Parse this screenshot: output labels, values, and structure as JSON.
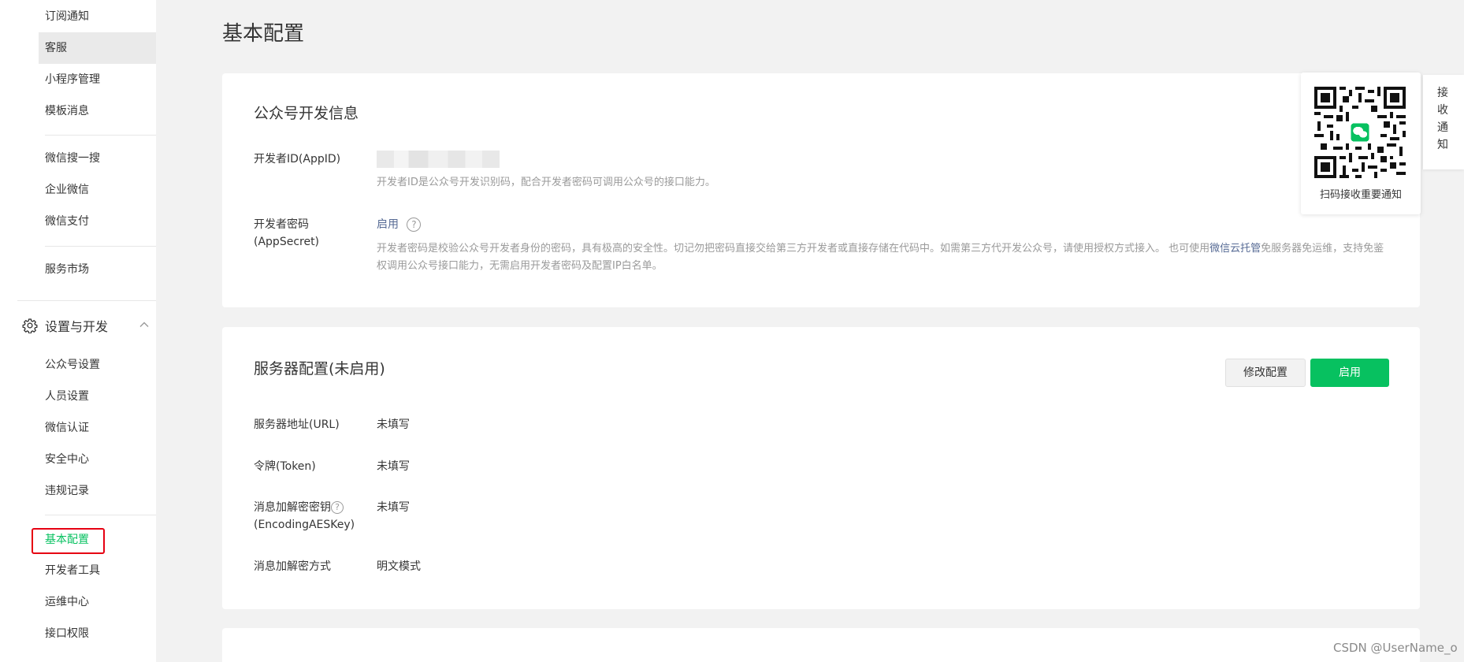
{
  "sidebar": {
    "items_top": [
      {
        "label": "订阅通知"
      },
      {
        "label": "客服"
      },
      {
        "label": "小程序管理"
      },
      {
        "label": "模板消息"
      },
      {
        "label": "微信搜一搜"
      },
      {
        "label": "企业微信"
      },
      {
        "label": "微信支付"
      },
      {
        "label": "服务市场"
      }
    ],
    "group": {
      "label": "设置与开发",
      "icon": "gear-icon"
    },
    "items_bottom": [
      {
        "label": "公众号设置"
      },
      {
        "label": "人员设置"
      },
      {
        "label": "微信认证"
      },
      {
        "label": "安全中心"
      },
      {
        "label": "违规记录"
      },
      {
        "label": "基本配置"
      },
      {
        "label": "开发者工具"
      },
      {
        "label": "运维中心"
      },
      {
        "label": "接口权限"
      }
    ],
    "active_item": "基本配置",
    "accent_color": "#07c160"
  },
  "page": {
    "title": "基本配置"
  },
  "dev_info": {
    "title": "公众号开发信息",
    "appid_label": "开发者ID(AppID)",
    "appid_desc": "开发者ID是公众号开发识别码，配合开发者密码可调用公众号的接口能力。",
    "secret_label": "开发者密码(AppSecret)",
    "secret_action": "启用",
    "help_icon": "?",
    "secret_desc_1": "开发者密码是校验公众号开发者身份的密码，具有极高的安全性。切记勿把密码直接交给第三方开发者或直接存储在代码中。如需第三方代开发公众号，请使用授权方式接入。 也可使用",
    "secret_desc_link": "微信云托管",
    "secret_desc_2": "免服务器免运维，支持免鉴权调用公众号接口能力，无需启用开发者密码及配置IP白名单。"
  },
  "server_config": {
    "title": "服务器配置(未启用)",
    "modify_button": "修改配置",
    "enable_button": "启用",
    "rows": [
      {
        "label": "服务器地址(URL)",
        "value": "未填写"
      },
      {
        "label": "令牌(Token)",
        "value": "未填写"
      },
      {
        "label": "消息加解密密钥",
        "label_2": "(EncodingAESKey)",
        "value": "未填写"
      },
      {
        "label": "消息加解密方式",
        "value": "明文模式"
      }
    ]
  },
  "qr": {
    "caption": "扫码接收重要通知"
  },
  "notify_tab": {
    "chars": [
      "接",
      "收",
      "通",
      "知"
    ]
  },
  "watermark": "CSDN @UserName_o"
}
